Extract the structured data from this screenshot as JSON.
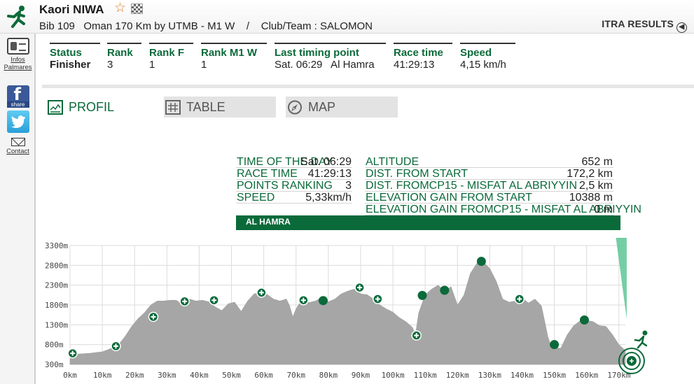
{
  "header": {
    "athlete_name": "Kaori NIWA",
    "race_line": "Bib 109   Oman 170 Km by UTMB - M1 W    /    Club/Team : SALOMON",
    "itra_label": "ITRA RESULTS",
    "icons": [
      "runner-icon",
      "star-icon",
      "checkered-flag-icon",
      "arrow-left-circle-icon"
    ]
  },
  "sidebar": {
    "infos": "Infos",
    "palmares": "Palmares",
    "facebook_share": "share",
    "contact": "Contact"
  },
  "stats": [
    {
      "label": "Status",
      "value": "Finisher"
    },
    {
      "label": "Rank",
      "value": "3"
    },
    {
      "label": "Rank F",
      "value": "1"
    },
    {
      "label": "Rank M1 W",
      "value": "1"
    },
    {
      "label": "Last timing point",
      "value": "Sat. 06:29   Al Hamra"
    },
    {
      "label": "Race time",
      "value": "41:29:13"
    },
    {
      "label": "Speed",
      "value": "4,15 km/h"
    }
  ],
  "tabs": {
    "profil": "PROFIL",
    "table": "TABLE",
    "map": "MAP"
  },
  "info_left": [
    {
      "k": "TIME OF THE DAY",
      "v": "Sat. 06:29"
    },
    {
      "k": "RACE TIME",
      "v": "41:29:13"
    },
    {
      "k": "POINTS RANKING",
      "v": "3"
    },
    {
      "k": "SPEED",
      "v": "5,33km/h"
    }
  ],
  "info_right": [
    {
      "k": "ALTITUDE",
      "v": "652 m"
    },
    {
      "k": "DIST. FROM START",
      "v": "172,2 km"
    },
    {
      "k": "DIST. FROMCP15 - MISFAT AL ABRIYYIN",
      "v": "2,5 km"
    },
    {
      "k": "ELEVATION GAIN FROM START",
      "v": "10388 m"
    },
    {
      "k": "ELEVATION GAIN FROMCP15 - MISFAT AL ABRIYYIN",
      "v": "0 m"
    }
  ],
  "pass_name": "AL HAMRA",
  "colors": {
    "accent": "#0b6a3a",
    "profile_fill": "#a6a6a6",
    "tab_bg": "#e3e3e3"
  },
  "chart_data": {
    "type": "area",
    "x_unit": "km",
    "y_unit": "m",
    "xlim": [
      0,
      172
    ],
    "ylim": [
      300,
      3300
    ],
    "x_ticks": [
      0,
      10,
      20,
      30,
      40,
      50,
      60,
      70,
      80,
      90,
      100,
      110,
      120,
      130,
      140,
      150,
      160,
      170
    ],
    "x_tick_labels": [
      "0km",
      "10km",
      "20km",
      "30km",
      "40km",
      "50km",
      "60km",
      "70km",
      "80km",
      "90km",
      "100km",
      "110km",
      "120km",
      "130km",
      "140km",
      "150km",
      "160km",
      "170km"
    ],
    "y_ticks": [
      300,
      800,
      1300,
      1800,
      2300,
      2800,
      3300
    ],
    "y_tick_labels": [
      "300m",
      "800m",
      "1300m",
      "1800m",
      "2300m",
      "2800m",
      "3300m"
    ],
    "grid": true,
    "profile": [
      [
        0,
        560
      ],
      [
        2,
        560
      ],
      [
        4,
        570
      ],
      [
        6,
        580
      ],
      [
        8,
        600
      ],
      [
        10,
        620
      ],
      [
        12,
        680
      ],
      [
        14,
        760
      ],
      [
        15,
        800
      ],
      [
        17,
        1000
      ],
      [
        19,
        1250
      ],
      [
        21,
        1450
      ],
      [
        23,
        1600
      ],
      [
        25,
        1800
      ],
      [
        27,
        1900
      ],
      [
        29,
        1900
      ],
      [
        31,
        1920
      ],
      [
        33,
        1920
      ],
      [
        35,
        1780
      ],
      [
        37,
        1950
      ],
      [
        39,
        1900
      ],
      [
        41,
        1920
      ],
      [
        43,
        1880
      ],
      [
        45,
        1750
      ],
      [
        47,
        1660
      ],
      [
        49,
        1830
      ],
      [
        51,
        1870
      ],
      [
        53,
        1640
      ],
      [
        55,
        1900
      ],
      [
        57,
        2080
      ],
      [
        59,
        2110
      ],
      [
        61,
        2070
      ],
      [
        63,
        1950
      ],
      [
        65,
        1900
      ],
      [
        67,
        1950
      ],
      [
        68,
        1780
      ],
      [
        69,
        1500
      ],
      [
        70,
        1700
      ],
      [
        72,
        1980
      ],
      [
        74,
        1860
      ],
      [
        76,
        1900
      ],
      [
        78,
        1990
      ],
      [
        80,
        1880
      ],
      [
        82,
        1950
      ],
      [
        84,
        2080
      ],
      [
        86,
        2150
      ],
      [
        88,
        2200
      ],
      [
        90,
        2080
      ],
      [
        92,
        2060
      ],
      [
        94,
        1950
      ],
      [
        96,
        1800
      ],
      [
        98,
        1700
      ],
      [
        100,
        1620
      ],
      [
        102,
        1480
      ],
      [
        104,
        1380
      ],
      [
        106,
        1240
      ],
      [
        107,
        1060
      ],
      [
        108,
        1600
      ],
      [
        110,
        2060
      ],
      [
        112,
        2200
      ],
      [
        114,
        2300
      ],
      [
        116,
        2150
      ],
      [
        118,
        2260
      ],
      [
        120,
        1800
      ],
      [
        122,
        2050
      ],
      [
        124,
        2600
      ],
      [
        126,
        2850
      ],
      [
        128,
        2890
      ],
      [
        130,
        2720
      ],
      [
        132,
        2400
      ],
      [
        134,
        1950
      ],
      [
        136,
        1870
      ],
      [
        138,
        1900
      ],
      [
        140,
        1980
      ],
      [
        142,
        1850
      ],
      [
        144,
        1950
      ],
      [
        146,
        1780
      ],
      [
        147,
        1400
      ],
      [
        148,
        1000
      ],
      [
        149,
        760
      ],
      [
        150,
        720
      ],
      [
        152,
        710
      ],
      [
        154,
        1050
      ],
      [
        156,
        1280
      ],
      [
        158,
        1400
      ],
      [
        160,
        1410
      ],
      [
        162,
        1380
      ],
      [
        164,
        1280
      ],
      [
        166,
        1260
      ],
      [
        168,
        1050
      ],
      [
        170,
        800
      ],
      [
        172,
        652
      ]
    ],
    "checkpoints_plus": [
      [
        0.8,
        580
      ],
      [
        14.2,
        760
      ],
      [
        25.8,
        1500
      ],
      [
        35.5,
        1890
      ],
      [
        44.6,
        1920
      ],
      [
        59.3,
        2110
      ],
      [
        72.3,
        1920
      ],
      [
        89.7,
        2240
      ],
      [
        95.3,
        1950
      ],
      [
        107.3,
        1030
      ],
      [
        139.2,
        1950
      ]
    ],
    "checkpoints_dot": [
      [
        78.4,
        1910
      ],
      [
        109.1,
        2040
      ],
      [
        116.0,
        2170
      ],
      [
        127.4,
        2900
      ],
      [
        150.0,
        800
      ],
      [
        159.3,
        1420
      ]
    ],
    "current_km": 172.2,
    "current_alt": 652
  }
}
